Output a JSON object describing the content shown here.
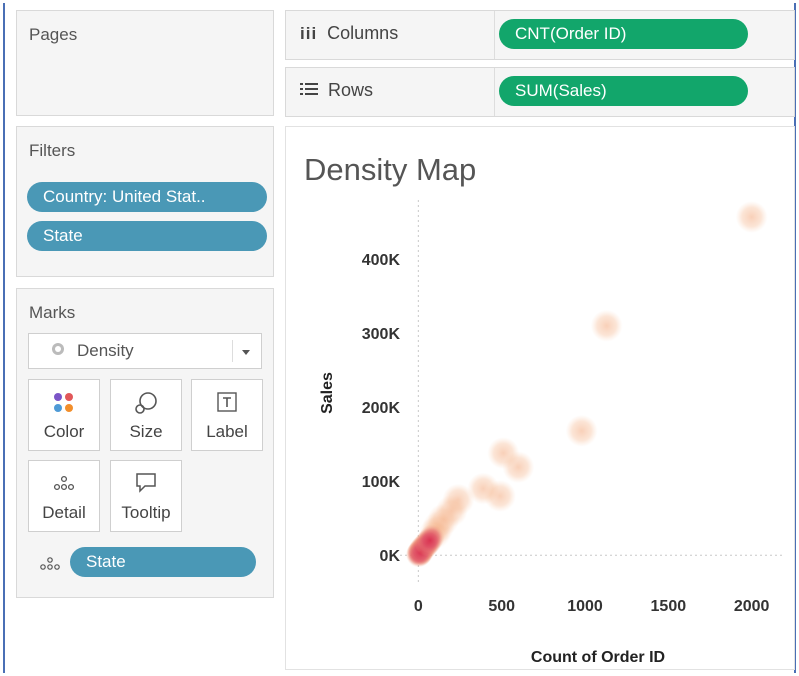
{
  "pages": {
    "title": "Pages"
  },
  "columns": {
    "label": "Columns",
    "pill": "CNT(Order ID)"
  },
  "rows": {
    "label": "Rows",
    "pill": "SUM(Sales)"
  },
  "filters": {
    "title": "Filters",
    "items": [
      "Country: United Stat..",
      "State"
    ]
  },
  "marks": {
    "title": "Marks",
    "type_selected": "Density",
    "buttons": {
      "color": "Color",
      "size": "Size",
      "label": "Label",
      "detail": "Detail",
      "tooltip": "Tooltip"
    },
    "detail_pill": "State"
  },
  "colors": {
    "pill_blue": "#4a98b6",
    "pill_green": "#12a66b",
    "density_hot": "#d9304f",
    "density_cool": "#f5b48a"
  },
  "chart_data": {
    "type": "scatter",
    "title": "Density Map",
    "xlabel": "Count of Order ID",
    "ylabel": "Sales",
    "xlim": [
      -50,
      2200
    ],
    "ylim": [
      -20000,
      480000
    ],
    "x_ticks": [
      0,
      500,
      1000,
      1500,
      2000
    ],
    "x_tick_labels": [
      "0",
      "500",
      "1000",
      "1500",
      "2000"
    ],
    "y_ticks": [
      0,
      100000,
      200000,
      300000,
      400000
    ],
    "y_tick_labels": [
      "0K",
      "100K",
      "200K",
      "300K",
      "400K"
    ],
    "grid": false,
    "points": [
      {
        "x": 2000,
        "y": 457000
      },
      {
        "x": 1130,
        "y": 310000
      },
      {
        "x": 980,
        "y": 168000
      },
      {
        "x": 510,
        "y": 138000
      },
      {
        "x": 600,
        "y": 119000
      },
      {
        "x": 390,
        "y": 90000
      },
      {
        "x": 490,
        "y": 80000
      },
      {
        "x": 240,
        "y": 75000
      },
      {
        "x": 200,
        "y": 60000
      },
      {
        "x": 150,
        "y": 48000
      },
      {
        "x": 120,
        "y": 38000
      },
      {
        "x": 100,
        "y": 30000
      },
      {
        "x": 80,
        "y": 24000
      },
      {
        "x": 60,
        "y": 18000
      },
      {
        "x": 45,
        "y": 14000
      },
      {
        "x": 30,
        "y": 10000
      },
      {
        "x": 20,
        "y": 7000
      },
      {
        "x": 12,
        "y": 5000
      },
      {
        "x": 8,
        "y": 3000
      },
      {
        "x": 5,
        "y": 2000
      },
      {
        "x": 3,
        "y": 1000
      },
      {
        "x": 40,
        "y": 12000
      },
      {
        "x": 25,
        "y": 9000
      },
      {
        "x": 15,
        "y": 4000
      },
      {
        "x": 55,
        "y": 16000
      },
      {
        "x": 70,
        "y": 20000
      }
    ]
  }
}
